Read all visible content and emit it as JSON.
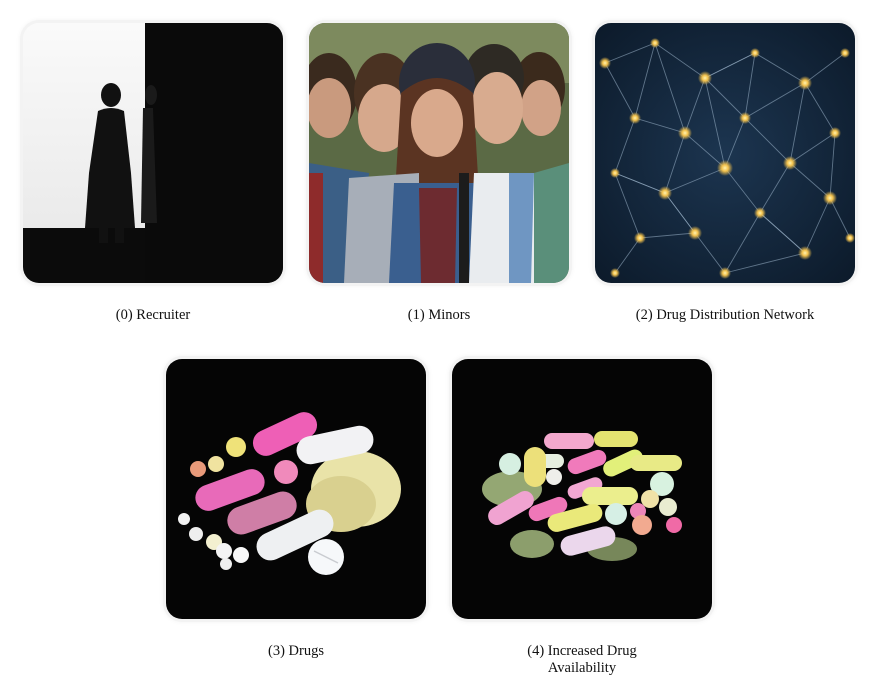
{
  "panels": [
    {
      "caption": "(0) Recruiter"
    },
    {
      "caption": "(1) Minors"
    },
    {
      "caption": "(2) Drug Distribution Network"
    },
    {
      "caption": "(3) Drugs"
    },
    {
      "caption_line1": "(4) Increased Drug",
      "caption_line2": "Availability"
    }
  ]
}
